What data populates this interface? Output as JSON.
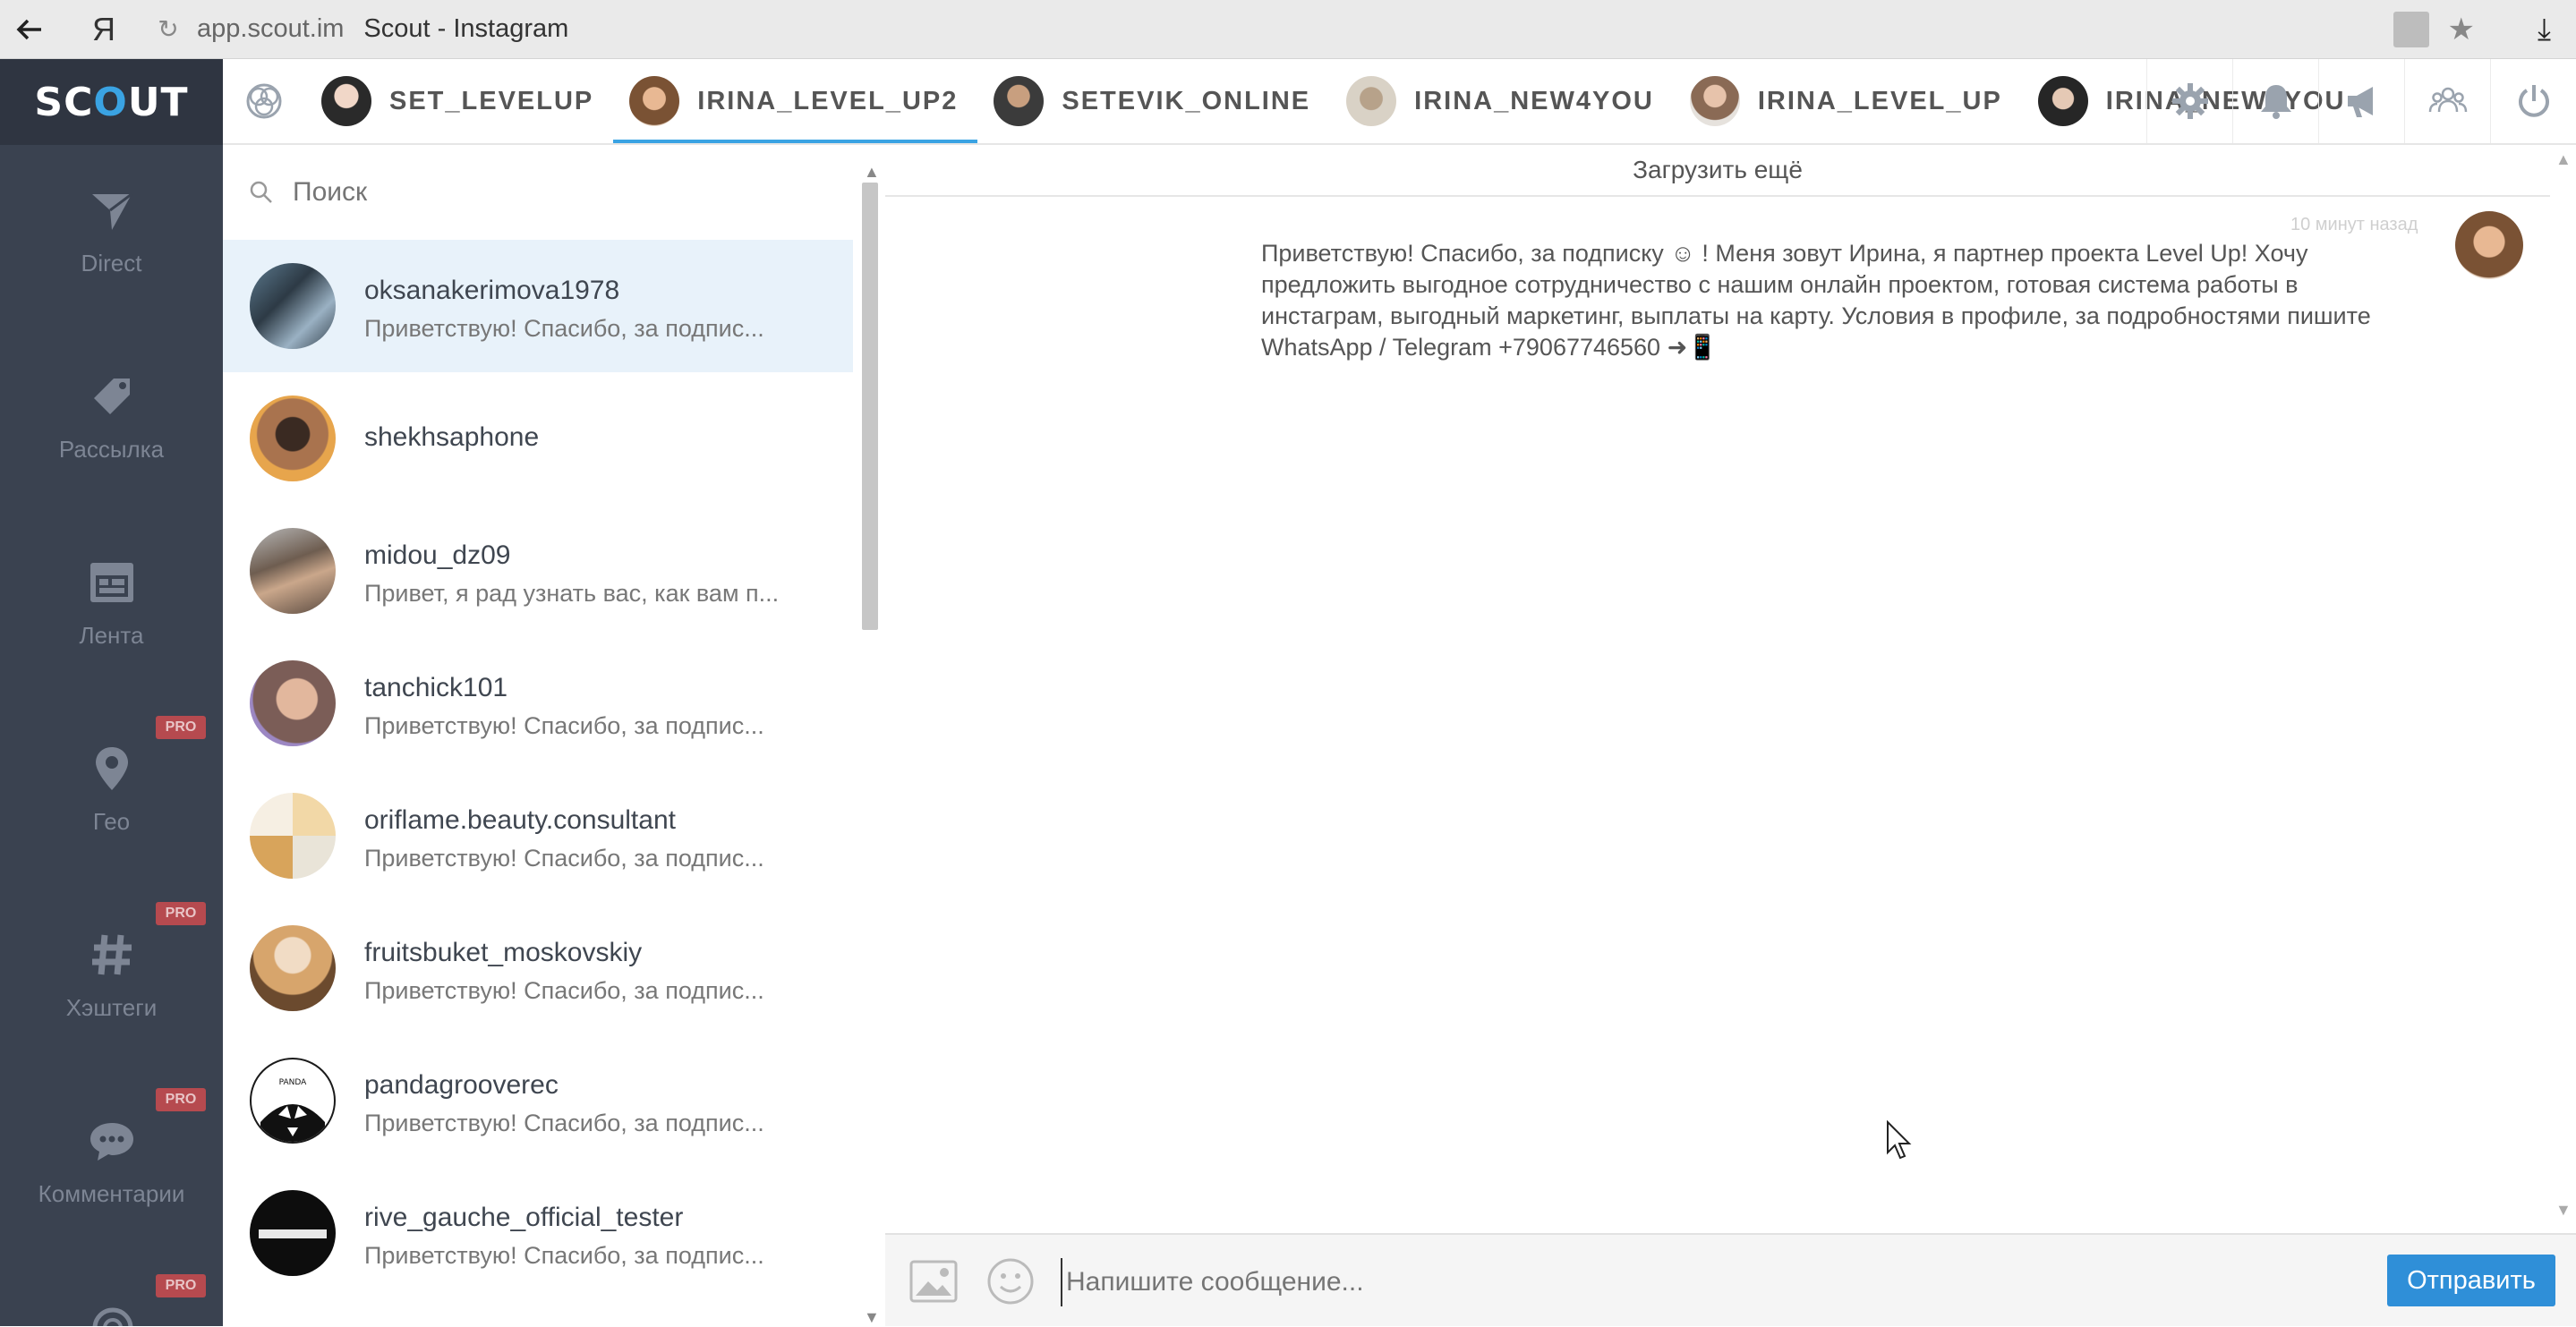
{
  "browser": {
    "back_icon": "arrow-left-icon",
    "yandex_glyph": "Я",
    "url": "app.scout.im",
    "page_title": "Scout - Instagram"
  },
  "app": {
    "logo_prefix": "SC",
    "logo_o": "O",
    "logo_suffix": "UT"
  },
  "sidebar": {
    "items": [
      {
        "label": "Direct",
        "icon": "paper-plane-icon",
        "pro": false
      },
      {
        "label": "Рассылка",
        "icon": "tag-icon",
        "pro": false
      },
      {
        "label": "Лента",
        "icon": "calendar-icon",
        "pro": false
      },
      {
        "label": "Гео",
        "icon": "location-pin-icon",
        "pro": true
      },
      {
        "label": "Хэштеги",
        "icon": "hashtag-icon",
        "pro": true
      },
      {
        "label": "Комментарии",
        "icon": "comment-icon",
        "pro": true
      }
    ],
    "pro_label": "PRO"
  },
  "accounts": {
    "tabs": [
      {
        "label": "SET_LEVELUP",
        "active": false
      },
      {
        "label": "IRINA_LEVEL_UP2",
        "active": true
      },
      {
        "label": "SETEVIK_ONLINE",
        "active": false
      },
      {
        "label": "IRINA_NEW4YOU",
        "active": false
      },
      {
        "label": "IRINA_LEVEL_UP",
        "active": false
      },
      {
        "label": "IRINA_NEW4YOU",
        "active": false
      }
    ],
    "right_icons": [
      "gear-icon",
      "bell-icon",
      "megaphone-icon",
      "users-icon",
      "power-icon"
    ]
  },
  "conversations": {
    "search_placeholder": "Поиск",
    "items": [
      {
        "name": "oksanakerimova1978",
        "preview": "Приветствую! Спасибо, за подпис...",
        "selected": true
      },
      {
        "name": "shekhsaphone",
        "preview": "",
        "selected": false
      },
      {
        "name": "midou_dz09",
        "preview": "Привет, я рад узнать вас, как вам п...",
        "selected": false
      },
      {
        "name": "tanchick101",
        "preview": "Приветствую! Спасибо, за подпис...",
        "selected": false
      },
      {
        "name": "oriflame.beauty.consultant",
        "preview": "Приветствую! Спасибо, за подпис...",
        "selected": false
      },
      {
        "name": "fruitsbuket_moskovskiy",
        "preview": "Приветствую! Спасибо, за подпис...",
        "selected": false
      },
      {
        "name": "pandagrooverec",
        "preview": "Приветствую! Спасибо, за подпис...",
        "selected": false
      },
      {
        "name": "rive_gauche_official_tester",
        "preview": "Приветствую! Спасибо, за подпис...",
        "selected": false
      }
    ]
  },
  "chat": {
    "load_more": "Загрузить ещё",
    "message_time": "10 минут назад",
    "message_text": "Приветствую! Спасибо, за подписку ☺ ! Меня зовут Ирина, я партнер проекта Level Up! Хочу предложить выгодное сотрудничество с нашим онлайн проектом, готовая система работы в инстаграм, выгодный маркетинг, выплаты на карту. Условия в профиле, за подробностями пишите WhatsApp / Telegram +79067746560 ➜📱",
    "composer_placeholder": "Напишите сообщение...",
    "send_label": "Отправить"
  },
  "colors": {
    "sidebar_bg": "#3a4250",
    "accent": "#3aa3e3",
    "send_button": "#2f8fd8",
    "pro_badge": "#b64a4f",
    "selected_row": "#e8f2fa"
  }
}
